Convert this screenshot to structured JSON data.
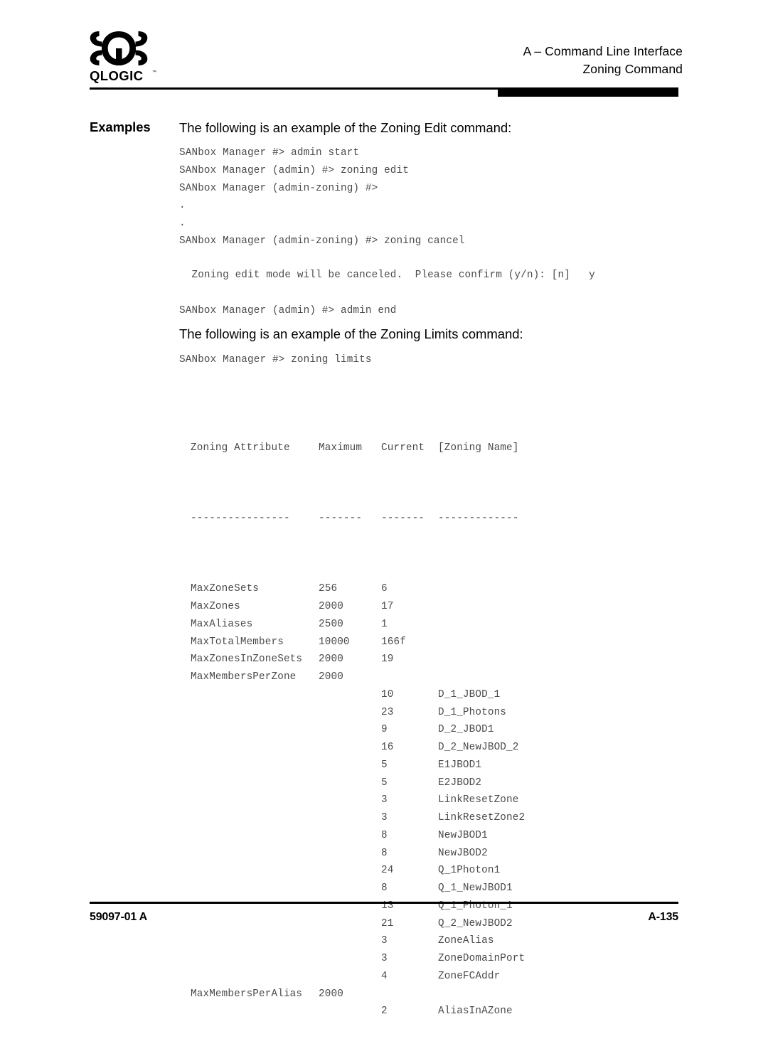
{
  "header": {
    "logo_name": "qlogic-logo",
    "wordmark": "QLOGIC",
    "line1": "A – Command Line Interface",
    "line2": "Zoning Command"
  },
  "section": {
    "label": "Examples",
    "intro_edit": "The following is an example of the Zoning Edit command:",
    "intro_limits": "The following is an example of the Zoning Limits command:"
  },
  "code_blocks": {
    "edit_session": "SANbox Manager #> admin start\nSANbox Manager (admin) #> zoning edit\nSANbox Manager (admin-zoning) #>\n.\n.\nSANbox Manager (admin-zoning) #> zoning cancel",
    "confirm": "  Zoning edit mode will be canceled.  Please confirm (y/n): [n]   y",
    "admin_end": "SANbox Manager (admin) #> admin end",
    "limits_command": "SANbox Manager #> zoning limits"
  },
  "limits_table": {
    "headers": {
      "attribute": "Zoning Attribute",
      "maximum": "Maximum",
      "current": "Current",
      "zoning_name": "[Zoning Name]"
    },
    "separators": {
      "attribute": "----------------",
      "maximum": "-------",
      "current": "-------",
      "zoning_name": "-------------"
    },
    "rows": [
      {
        "attribute": "MaxZoneSets",
        "maximum": "256",
        "current": "6",
        "zoning_name": ""
      },
      {
        "attribute": "MaxZones",
        "maximum": "2000",
        "current": "17",
        "zoning_name": ""
      },
      {
        "attribute": "MaxAliases",
        "maximum": "2500",
        "current": "1",
        "zoning_name": ""
      },
      {
        "attribute": "MaxTotalMembers",
        "maximum": "10000",
        "current": "166f",
        "zoning_name": ""
      },
      {
        "attribute": "MaxZonesInZoneSets",
        "maximum": "2000",
        "current": "19",
        "zoning_name": ""
      },
      {
        "attribute": "MaxMembersPerZone",
        "maximum": "2000",
        "current": "",
        "zoning_name": ""
      },
      {
        "attribute": "",
        "maximum": "",
        "current": "10",
        "zoning_name": "D_1_JBOD_1"
      },
      {
        "attribute": "",
        "maximum": "",
        "current": "23",
        "zoning_name": "D_1_Photons"
      },
      {
        "attribute": "",
        "maximum": "",
        "current": "9",
        "zoning_name": "D_2_JBOD1"
      },
      {
        "attribute": "",
        "maximum": "",
        "current": "16",
        "zoning_name": "D_2_NewJBOD_2"
      },
      {
        "attribute": "",
        "maximum": "",
        "current": "5",
        "zoning_name": "E1JBOD1"
      },
      {
        "attribute": "",
        "maximum": "",
        "current": "5",
        "zoning_name": "E2JBOD2"
      },
      {
        "attribute": "",
        "maximum": "",
        "current": "3",
        "zoning_name": "LinkResetZone"
      },
      {
        "attribute": "",
        "maximum": "",
        "current": "3",
        "zoning_name": "LinkResetZone2"
      },
      {
        "attribute": "",
        "maximum": "",
        "current": "8",
        "zoning_name": "NewJBOD1"
      },
      {
        "attribute": "",
        "maximum": "",
        "current": "8",
        "zoning_name": "NewJBOD2"
      },
      {
        "attribute": "",
        "maximum": "",
        "current": "24",
        "zoning_name": "Q_1Photon1"
      },
      {
        "attribute": "",
        "maximum": "",
        "current": "8",
        "zoning_name": "Q_1_NewJBOD1"
      },
      {
        "attribute": "",
        "maximum": "",
        "current": "13",
        "zoning_name": "Q_1_Photon_1"
      },
      {
        "attribute": "",
        "maximum": "",
        "current": "21",
        "zoning_name": "Q_2_NewJBOD2"
      },
      {
        "attribute": "",
        "maximum": "",
        "current": "3",
        "zoning_name": "ZoneAlias"
      },
      {
        "attribute": "",
        "maximum": "",
        "current": "3",
        "zoning_name": "ZoneDomainPort"
      },
      {
        "attribute": "",
        "maximum": "",
        "current": "4",
        "zoning_name": "ZoneFCAddr"
      },
      {
        "attribute": "MaxMembersPerAlias",
        "maximum": "2000",
        "current": "",
        "zoning_name": ""
      },
      {
        "attribute": "",
        "maximum": "",
        "current": "2",
        "zoning_name": "AliasInAZone"
      }
    ]
  },
  "footer": {
    "doc_number": "59097-01 A",
    "page_number": "A-135"
  },
  "colors": {
    "text": "#000000",
    "code_text": "#4a4a4a",
    "rule": "#000000"
  }
}
